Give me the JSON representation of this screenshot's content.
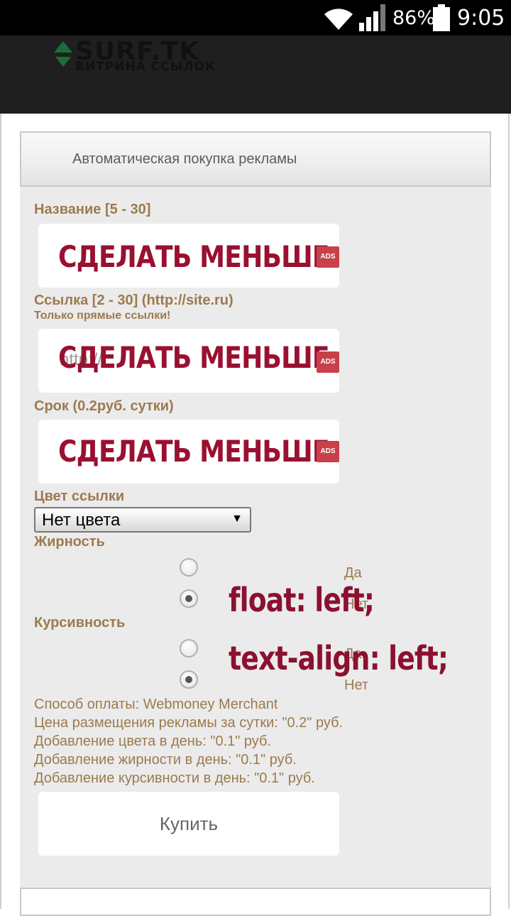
{
  "status_bar": {
    "battery": "86%",
    "time": "9:05",
    "icons": [
      "wifi-icon",
      "signal-icon",
      "battery-icon"
    ]
  },
  "header": {
    "logo_title": "SURF.TK",
    "logo_subtitle": "ВИТРИНА ССЫЛОК"
  },
  "panel": {
    "title": "Автоматическая покупка рекламы"
  },
  "form": {
    "name_label": "Название [5 - 30]",
    "link_label": "Ссылка [2 - 30] (http://site.ru)",
    "link_note": "Только прямые ссылки!",
    "link_placeholder": "http://",
    "term_label": "Срок (0.2руб. сутки)",
    "color_label": "Цвет ссылки",
    "color_value": "Нет цвета",
    "bold_label": "Жирность",
    "italic_label": "Курсивность",
    "option_yes": "Да",
    "option_no": "Нет"
  },
  "ads": {
    "banner_text": "СДЕЛАТЬ МЕНЬШЕ",
    "badge": "ADS"
  },
  "overlay": {
    "line1": "float: left;",
    "line2": "text-align: left;"
  },
  "info": {
    "payment": "Способ оплаты: Webmoney Merchant",
    "price": "Цена размещения рекламы за сутки: \"0.2\" руб.",
    "color_price": "Добавление цвета в день: \"0.1\" руб.",
    "bold_price": "Добавление жирности в день: \"0.1\" руб.",
    "italic_price": "Добавление курсивности в день: \"0.1\" руб."
  },
  "buy_button": "Купить",
  "colors": {
    "label": "#9c7a4e",
    "ad_text": "#9a1030",
    "panel_bg": "#ebebeb"
  }
}
